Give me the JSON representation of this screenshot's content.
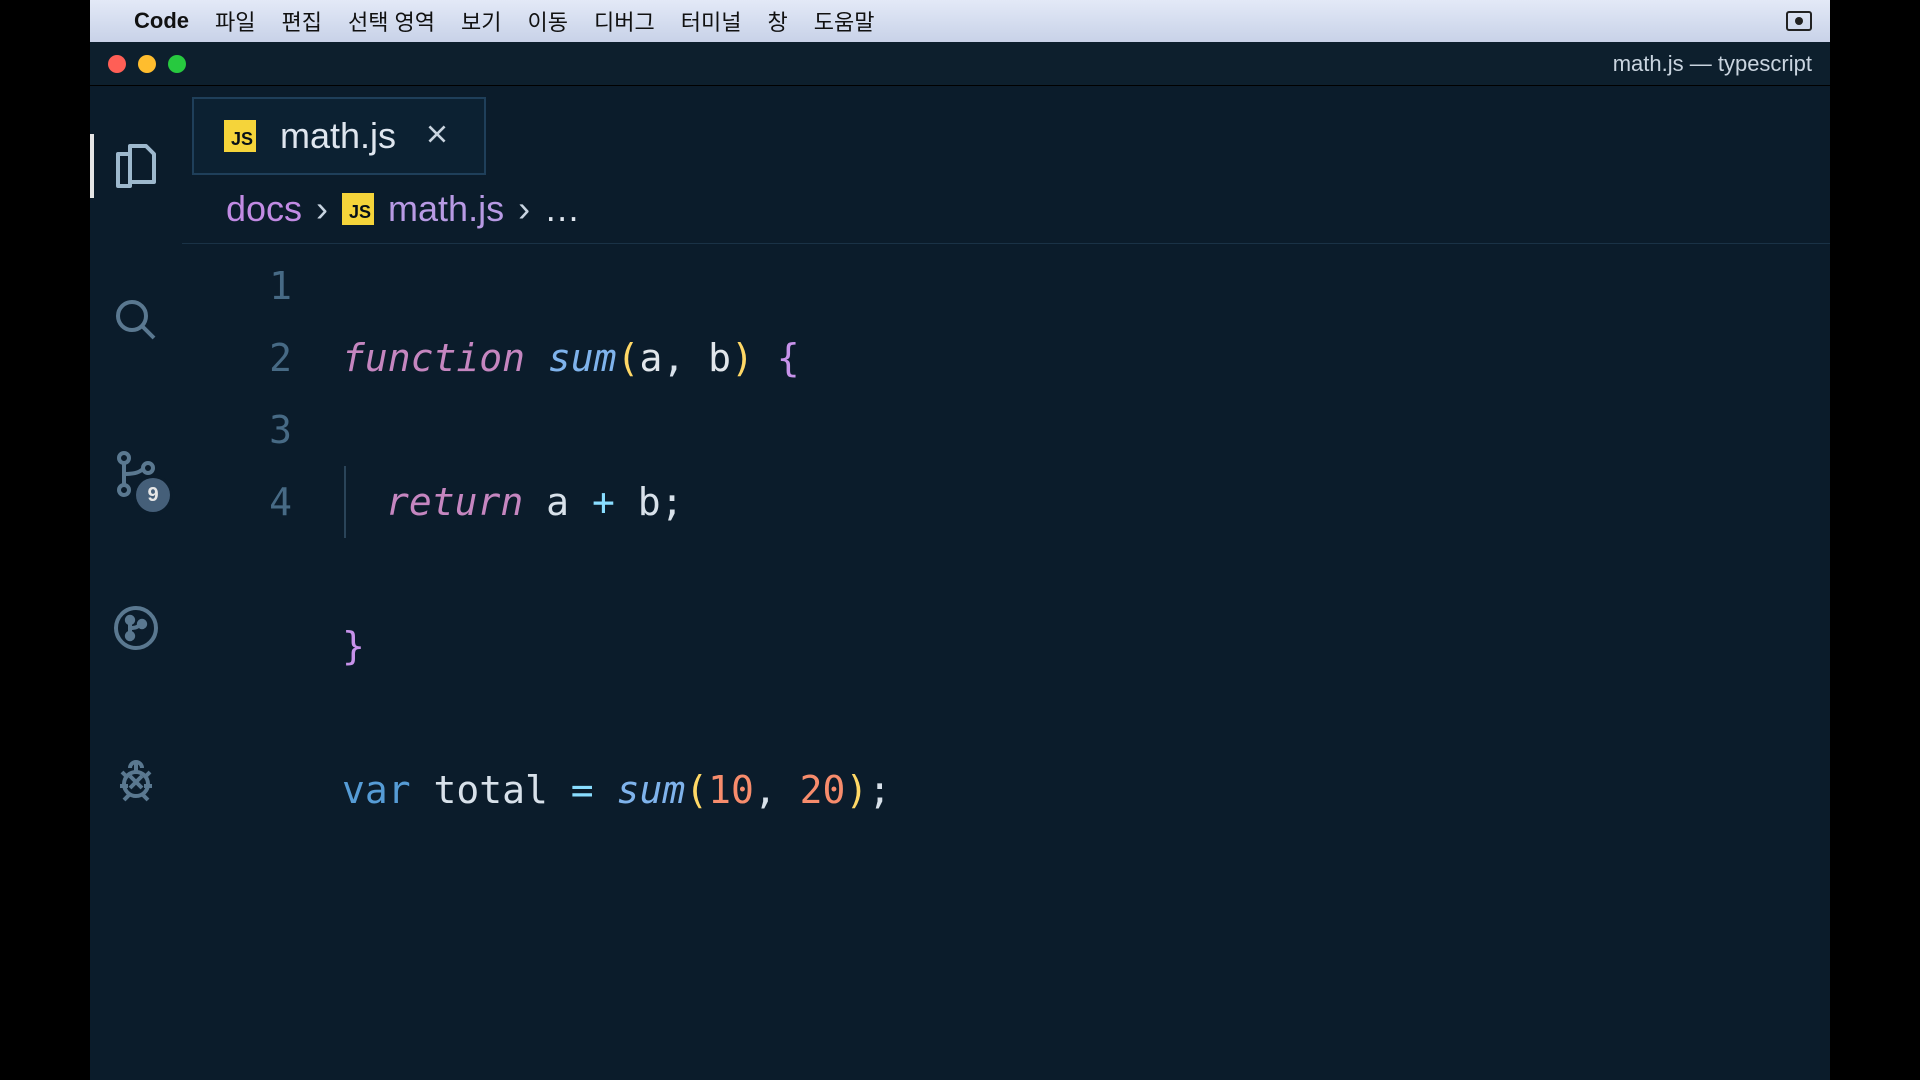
{
  "menubar": {
    "app": "Code",
    "items": [
      "파일",
      "편집",
      "선택 영역",
      "보기",
      "이동",
      "디버그",
      "터미널",
      "창",
      "도움말"
    ]
  },
  "window": {
    "title": "math.js — typescript"
  },
  "activity": {
    "scm_badge": "9"
  },
  "tab": {
    "icon_text": "JS",
    "filename": "math.js"
  },
  "breadcrumb": {
    "folder": "docs",
    "icon_text": "JS",
    "filename": "math.js",
    "rest": "…"
  },
  "code": {
    "line_numbers": [
      "1",
      "2",
      "3",
      "4"
    ],
    "l1": {
      "kw": "function",
      "fn": "sum",
      "lp": "(",
      "a": "a",
      "c1": ", ",
      "b": "b",
      "rp": ")",
      "sp": " ",
      "lb": "{"
    },
    "l2": {
      "kw": "return",
      "a": "a",
      "op": " + ",
      "b": "b",
      "semi": ";"
    },
    "l3": {
      "rb": "}"
    },
    "l4": {
      "kw": "var",
      "name": " total ",
      "eq": "= ",
      "fn": "sum",
      "lp": "(",
      "n1": "10",
      "c": ", ",
      "n2": "20",
      "rp": ")",
      "semi": ";"
    }
  }
}
